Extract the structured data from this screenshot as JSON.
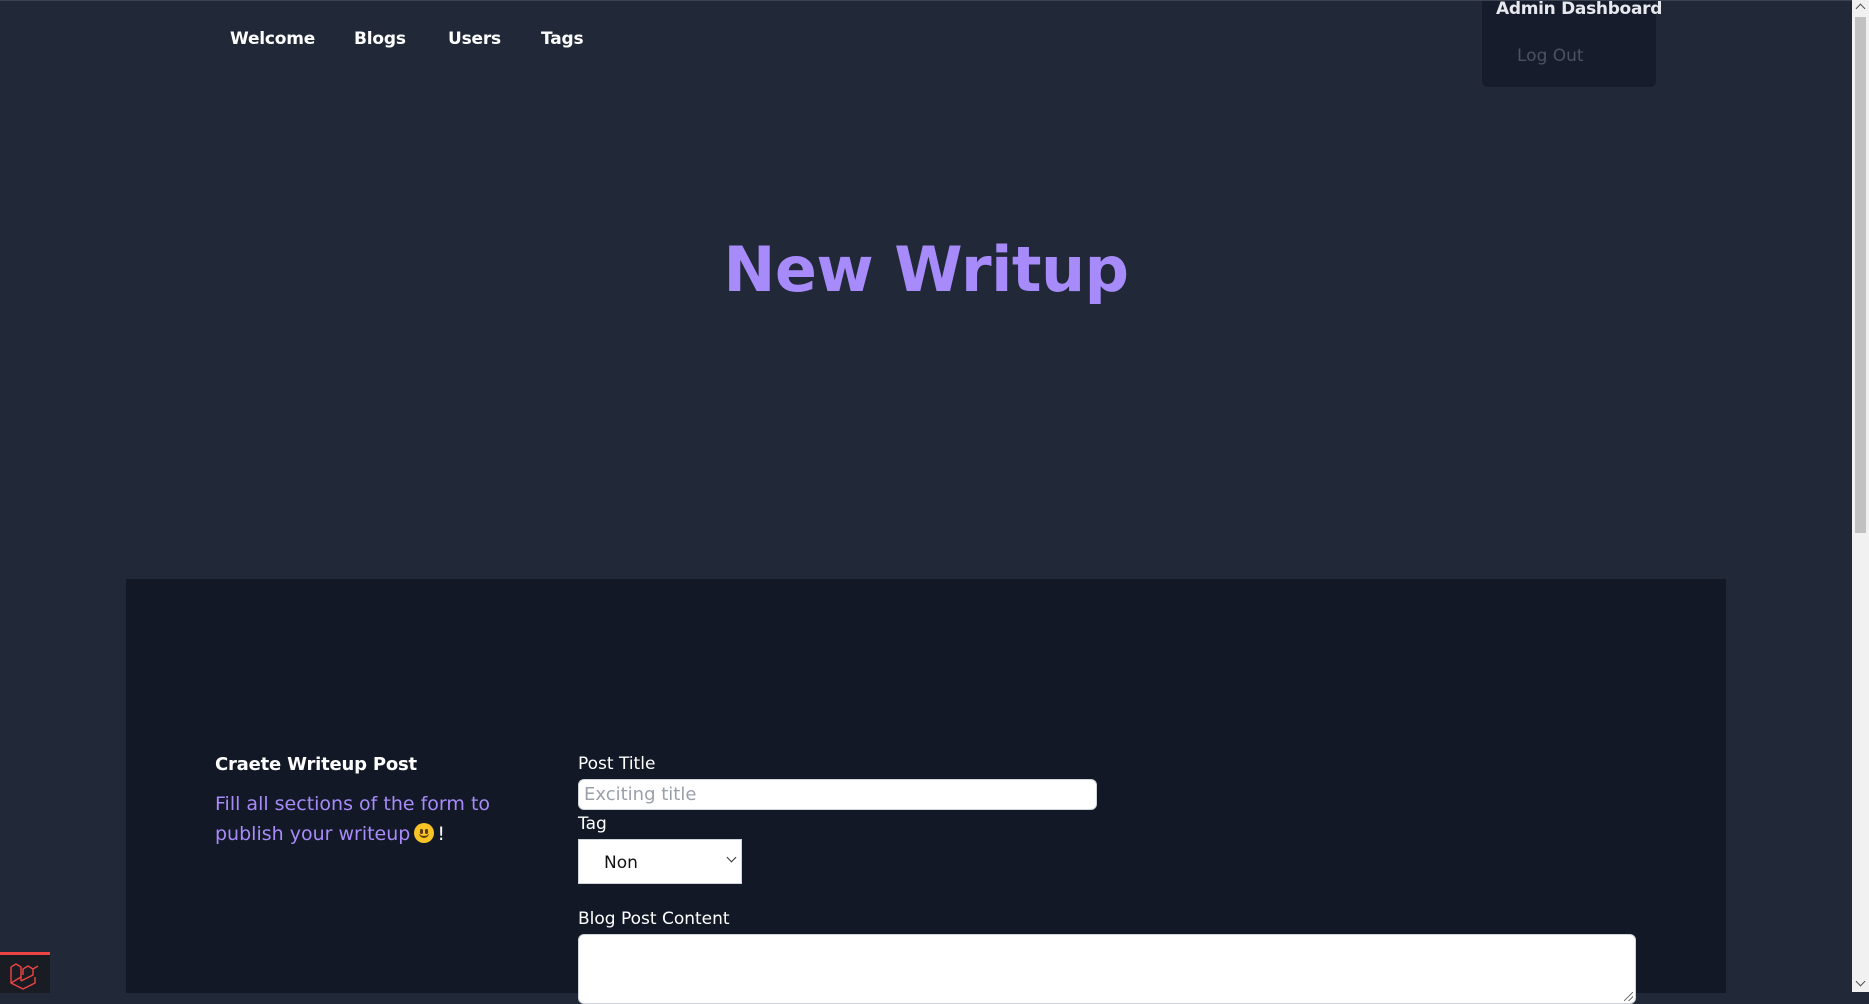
{
  "nav": {
    "links": [
      {
        "label": "Welcome"
      },
      {
        "label": "Blogs"
      },
      {
        "label": "Users"
      },
      {
        "label": "Tags"
      }
    ]
  },
  "user_menu": {
    "title": "Admin Dashboard",
    "items": [
      {
        "label": "Log Out"
      }
    ]
  },
  "hero": {
    "title": "New Writup"
  },
  "form": {
    "section_title": "Craete Writeup Post",
    "section_desc_prefix": "Fill all sections of the form to publish your writeup",
    "section_desc_suffix": "!",
    "emoji_icon": "slightly-smiling-face-icon",
    "title_label": "Post Title",
    "title_placeholder": "Exciting title",
    "title_value": "",
    "tag_label": "Tag",
    "tag_selected": "Non",
    "content_label": "Blog Post Content",
    "content_value": ""
  },
  "colors": {
    "background": "#212938",
    "panel": "#121826",
    "accent": "#a78bfa",
    "badge_accent": "#ef4444"
  },
  "icons": {
    "dev_badge": "laravel-logo-icon",
    "scroll_up": "chevron-up-icon",
    "scroll_down": "chevron-down-icon",
    "select_arrow": "chevron-down-icon"
  }
}
